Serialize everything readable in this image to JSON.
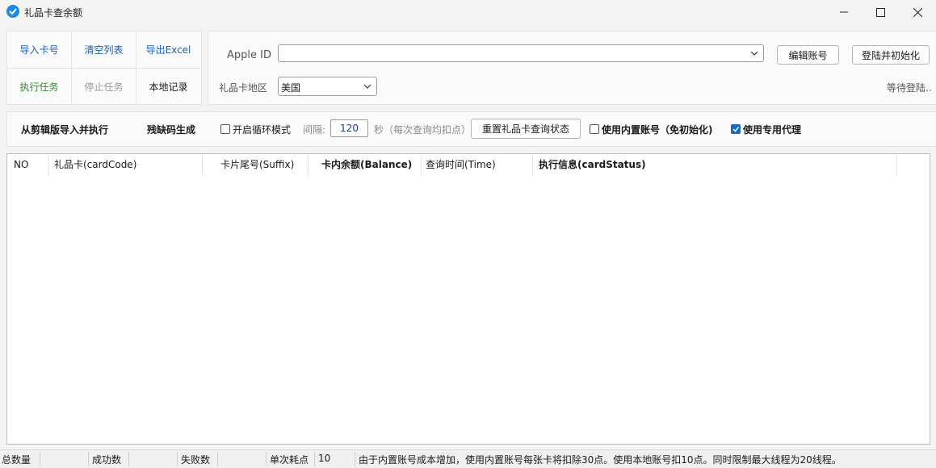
{
  "window": {
    "title": "礼品卡查余额",
    "minimize": "—",
    "maximize": "☐",
    "close": "✕"
  },
  "left_buttons": {
    "import_cards": "导入卡号",
    "clear_list": "清空列表",
    "export_excel": "导出Excel",
    "run_task": "执行任务",
    "stop_task": "停止任务",
    "local_records": "本地记录"
  },
  "account": {
    "apple_id_label": "Apple ID",
    "apple_id_value": "",
    "edit_account": "编辑账号",
    "login_init": "登陆并初始化",
    "region_label": "礼品卡地区",
    "region_value": "美国",
    "login_status": "等待登陆.."
  },
  "options": {
    "import_clipboard": "从剪辑版导入并执行",
    "missing_code": "残缺码生成",
    "loop_mode_label": "开启循环模式",
    "loop_mode_checked": false,
    "interval_label": "间隔:",
    "interval_value": "120",
    "interval_unit": "秒（每次查询均扣点）",
    "reset_status": "重置礼品卡查询状态",
    "builtin_account_label": "使用内置账号（免初始化)",
    "builtin_account_checked": false,
    "dedicated_proxy_label": "使用专用代理",
    "dedicated_proxy_checked": true
  },
  "table": {
    "columns": [
      "NO",
      "礼品卡(cardCode)",
      "卡片尾号(Suffix)",
      "卡内余额(Balance)",
      "查询时间(Time)",
      "执行信息(cardStatus)"
    ],
    "rows": []
  },
  "status": {
    "total_label": "总数量",
    "total_value": "",
    "success_label": "成功数",
    "success_value": "",
    "fail_label": "失败数",
    "fail_value": "",
    "cost_label": "单次耗点",
    "cost_value": "10",
    "notice": "由于内置账号成本增加，使用内置账号每张卡将扣除30点。使用本地账号扣10点。同时限制最大线程为20线程。"
  },
  "colors": {
    "link_blue": "#1a5fb4",
    "run_green": "#2e8b2e",
    "disabled_grey": "#9a9a9a",
    "accent": "#1a66c9"
  }
}
